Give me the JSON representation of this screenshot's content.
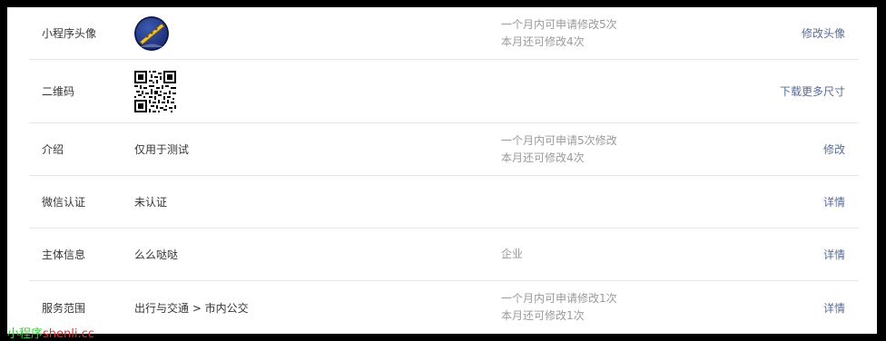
{
  "rows": [
    {
      "label": "小程序头像",
      "value": "",
      "note_lines": [
        "一个月内可申请修改5次",
        "本月还可修改4次"
      ],
      "action": "修改头像"
    },
    {
      "label": "二维码",
      "value": "",
      "note_lines": [],
      "action": "下载更多尺寸"
    },
    {
      "label": "介绍",
      "value": "仅用于测试",
      "note_lines": [
        "一个月内可申请5次修改",
        "本月还可修改4次"
      ],
      "action": "修改"
    },
    {
      "label": "微信认证",
      "value": "未认证",
      "note_lines": [],
      "action": "详情"
    },
    {
      "label": "主体信息",
      "value": "么么哒哒",
      "note_lines": [
        "企业"
      ],
      "action": "详情"
    },
    {
      "label": "服务范围",
      "value": "出行与交通 > 市内公交",
      "note_lines": [
        "一个月内可申请修改1次",
        "本月还可修改1次"
      ],
      "action": "详情"
    }
  ],
  "watermark": {
    "part1": "小程序",
    "part2": "shenli.cc"
  },
  "colors": {
    "link": "#576b95",
    "muted": "#9a9a9a",
    "text": "#353535",
    "divider": "#e7e7eb"
  },
  "icons": {
    "avatar": "avatar-image",
    "qr": "qr-code-image"
  }
}
